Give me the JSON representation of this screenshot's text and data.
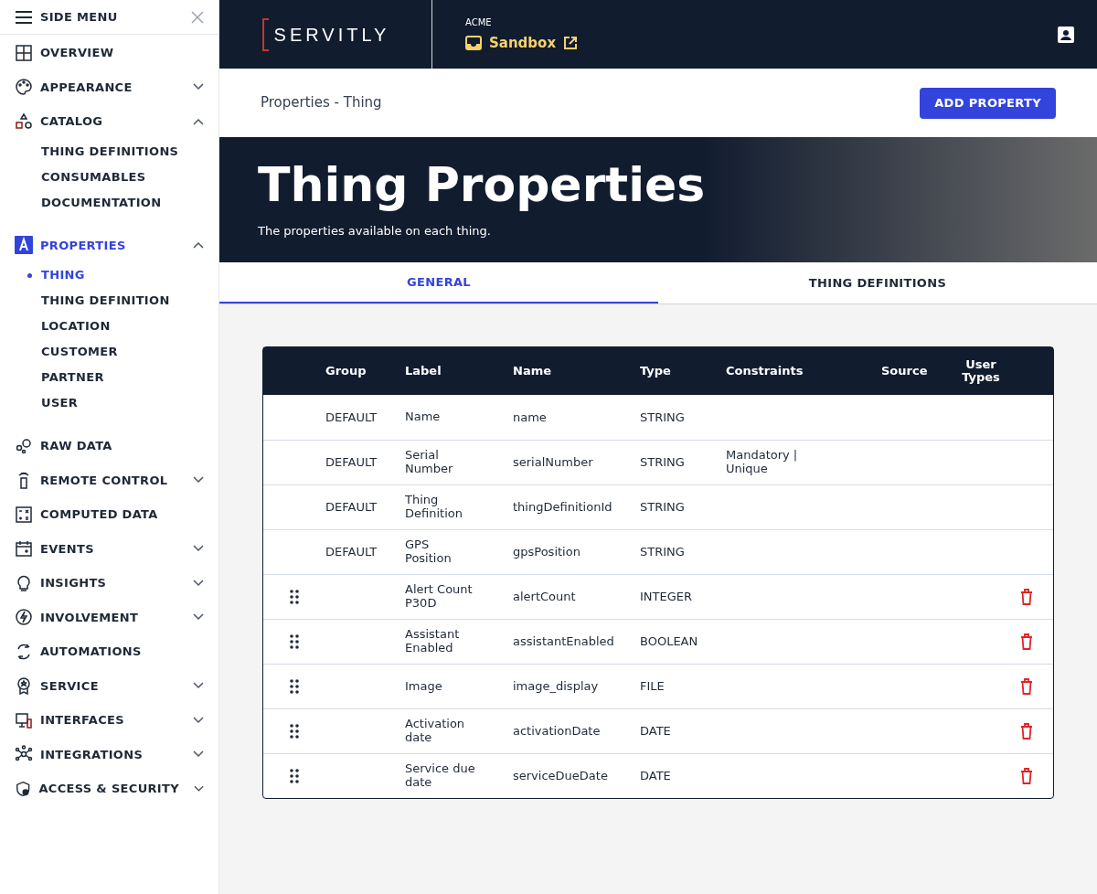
{
  "side_menu": {
    "title": "SIDE MENU",
    "items": [
      {
        "label": "OVERVIEW",
        "selected": false
      },
      {
        "label": "APPEARANCE",
        "selected": false,
        "expanded": false
      },
      {
        "label": "CATALOG",
        "selected": false,
        "expanded": true,
        "children": [
          {
            "label": "THING DEFINITIONS",
            "selected": false
          },
          {
            "label": "CONSUMABLES",
            "selected": false
          },
          {
            "label": "DOCUMENTATION",
            "selected": false
          }
        ]
      },
      {
        "label": "PROPERTIES",
        "selected": true,
        "expanded": true,
        "children": [
          {
            "label": "THING",
            "selected": true
          },
          {
            "label": "THING DEFINITION",
            "selected": false
          },
          {
            "label": "LOCATION",
            "selected": false
          },
          {
            "label": "CUSTOMER",
            "selected": false
          },
          {
            "label": "PARTNER",
            "selected": false
          },
          {
            "label": "USER",
            "selected": false
          }
        ]
      },
      {
        "label": "RAW DATA",
        "selected": false
      },
      {
        "label": "REMOTE CONTROL",
        "selected": false,
        "expanded": false
      },
      {
        "label": "COMPUTED DATA",
        "selected": false
      },
      {
        "label": "EVENTS",
        "selected": false,
        "expanded": false
      },
      {
        "label": "INSIGHTS",
        "selected": false,
        "expanded": false
      },
      {
        "label": "INVOLVEMENT",
        "selected": false,
        "expanded": false
      },
      {
        "label": "AUTOMATIONS",
        "selected": false
      },
      {
        "label": "SERVICE",
        "selected": false,
        "expanded": false
      },
      {
        "label": "INTERFACES",
        "selected": false,
        "expanded": false
      },
      {
        "label": "INTEGRATIONS",
        "selected": false,
        "expanded": false
      },
      {
        "label": "ACCESS & SECURITY",
        "selected": false,
        "expanded": false
      }
    ]
  },
  "header": {
    "logo": "SERVITLY",
    "tenant": "ACME",
    "environment": "Sandbox"
  },
  "breadcrumb": "Properties - Thing",
  "add_button": "ADD PROPERTY",
  "banner": {
    "title": "Thing Properties",
    "subtitle": "The properties available on each thing."
  },
  "tabs": [
    {
      "label": "GENERAL",
      "selected": true
    },
    {
      "label": "THING DEFINITIONS",
      "selected": false
    }
  ],
  "table": {
    "columns": [
      "Group",
      "Label",
      "Name",
      "Type",
      "Constraints",
      "Source",
      "User Types"
    ],
    "rows": [
      {
        "kind": "default",
        "cells": [
          "DEFAULT",
          "Name",
          "name",
          "STRING",
          ""
        ]
      },
      {
        "kind": "default",
        "cells": [
          "DEFAULT",
          "Serial Number",
          "serialNumber",
          "STRING",
          "Mandatory | Unique"
        ]
      },
      {
        "kind": "default",
        "cells": [
          "DEFAULT",
          "Thing Definition",
          "thingDefinitionId",
          "STRING",
          ""
        ]
      },
      {
        "kind": "default",
        "cells": [
          "DEFAULT",
          "GPS Position",
          "gpsPosition",
          "STRING",
          ""
        ]
      },
      {
        "kind": "custom",
        "cells": [
          "",
          "Alert Count P30D",
          "alertCount",
          "INTEGER",
          ""
        ]
      },
      {
        "kind": "custom",
        "cells": [
          "",
          "Assistant Enabled",
          "assistantEnabled",
          "BOOLEAN",
          ""
        ]
      },
      {
        "kind": "custom",
        "cells": [
          "",
          "Image",
          "image_display",
          "FILE",
          ""
        ]
      },
      {
        "kind": "custom",
        "cells": [
          "",
          "Activation date",
          "activationDate",
          "DATE",
          ""
        ]
      },
      {
        "kind": "custom",
        "cells": [
          "",
          "Service due date",
          "serviceDueDate",
          "DATE",
          ""
        ]
      }
    ]
  }
}
